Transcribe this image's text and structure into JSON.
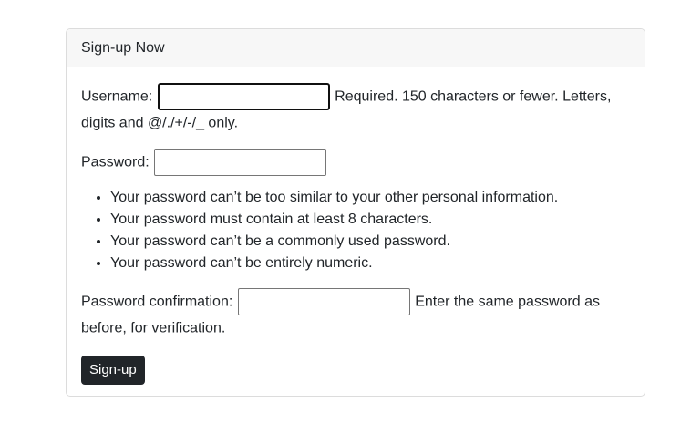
{
  "card": {
    "title": "Sign-up Now"
  },
  "form": {
    "username": {
      "label": "Username:",
      "value": "",
      "help": "Required. 150 characters or fewer. Letters, digits and @/./+/-/_ only."
    },
    "password": {
      "label": "Password:",
      "value": ""
    },
    "password_rules": [
      "Your password can’t be too similar to your other personal information.",
      "Your password must contain at least 8 characters.",
      "Your password can’t be a commonly used password.",
      "Your password can’t be entirely numeric."
    ],
    "password_confirmation": {
      "label": "Password confirmation:",
      "value": "",
      "help": "Enter the same password as before, for verification."
    },
    "submit_label": "Sign-up"
  },
  "colors": {
    "button_bg": "#212529",
    "header_bg": "#f7f7f7",
    "border": "#dcdcdc"
  }
}
